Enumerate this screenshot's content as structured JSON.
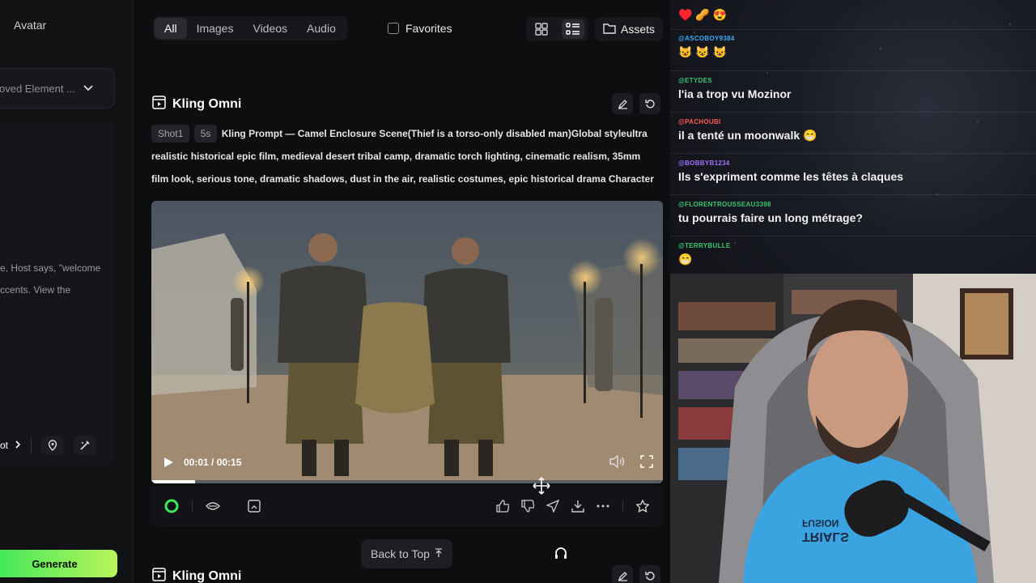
{
  "left_panel": {
    "tab_label": "Avatar",
    "dropdown_value": "oved Element ...",
    "text_lines": [
      "e, Host says, \"welcome",
      "ccents. View the"
    ],
    "shot_label": "ot",
    "generate_label": "Generate"
  },
  "filters": {
    "tabs": [
      {
        "label": "All",
        "active": true
      },
      {
        "label": "Images",
        "active": false
      },
      {
        "label": "Videos",
        "active": false
      },
      {
        "label": "Audio",
        "active": false
      }
    ],
    "favorites_label": "Favorites",
    "assets_label": "Assets"
  },
  "card1": {
    "title": "Kling Omni",
    "shot_chip": "Shot1",
    "duration_chip": "5s",
    "prompt": "Kling Prompt — Camel Enclosure Scene(Thief is a torso-only disabled man)Global styleultra realistic historical epic film, medieval desert tribal camp, dramatic torch lighting, cinematic realism, 35mm film look, serious tone, dramatic shadows, dust in the air, realistic costumes, epic historical drama Character",
    "video": {
      "time": "00:01 / 00:15",
      "progress": 0.085
    }
  },
  "card2": {
    "title": "Kling Omni"
  },
  "back_to_top_label": "Back to Top",
  "chat": {
    "messages": [
      {
        "user": "",
        "text": "♥️ 🥜 😍",
        "color": "#ffffff"
      },
      {
        "user": "@ASCOBOY9384",
        "text": "😺 😺 😺",
        "color": "#3fa9f5"
      },
      {
        "user": "@ETYDES",
        "text": "l'ia a trop vu Mozinor",
        "color": "#37c871"
      },
      {
        "user": "@PACHOUBI",
        "text": "il a tenté un moonwalk 😁",
        "color": "#ff5a5a"
      },
      {
        "user": "@BOBBYB1234",
        "text": "Ils s'expriment comme les têtes à claques",
        "color": "#a070ff"
      },
      {
        "user": "@FLORENTROUSSEAU3398",
        "text": "tu pourrais faire un long métrage?",
        "color": "#37c871"
      },
      {
        "user": "@TERRYBULLE",
        "text": "😁",
        "color": "#37c871"
      }
    ]
  },
  "webcam": {
    "shirt_text_1": "TRIALS",
    "shirt_text_2": "FUSION"
  },
  "colors": {
    "accent_green": "#3de85a",
    "bg_dark": "#0d0e10"
  }
}
